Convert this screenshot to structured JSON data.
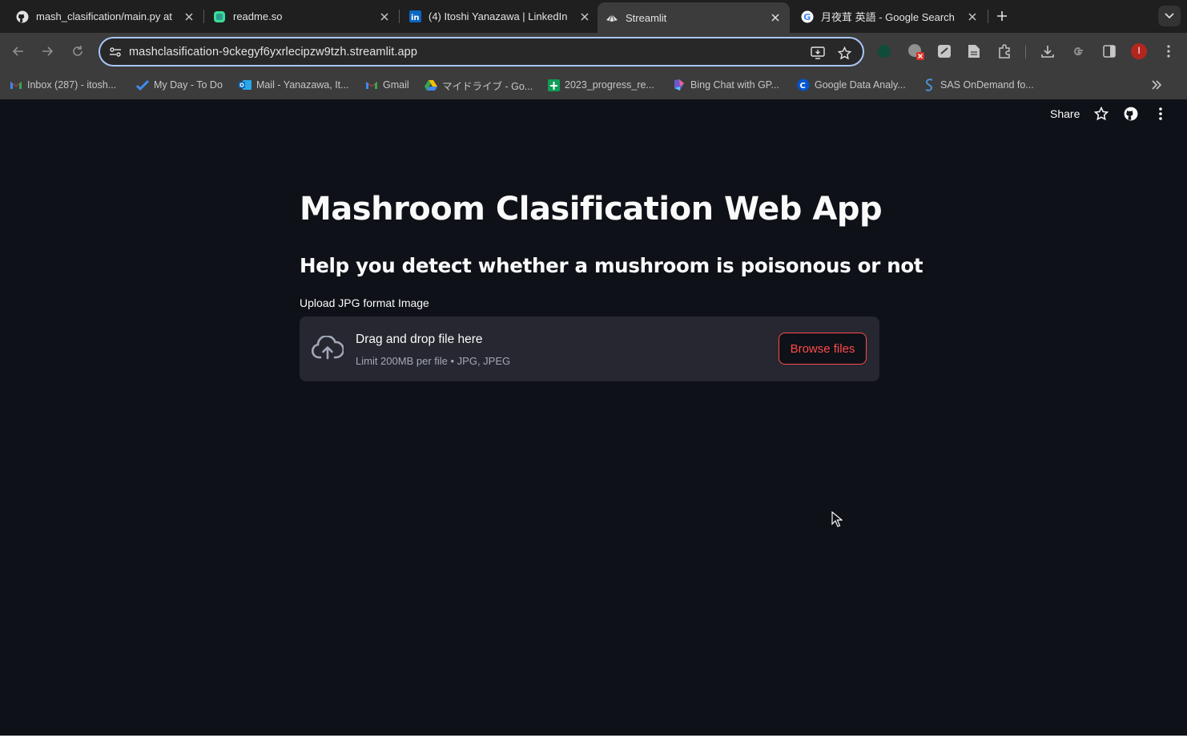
{
  "browser": {
    "tabs": [
      {
        "title": "mash_clasification/main.py at",
        "icon": "github-icon"
      },
      {
        "title": "readme.so",
        "icon": "readme-icon"
      },
      {
        "title": "(4) Itoshi Yanazawa | LinkedIn",
        "icon": "linkedin-icon"
      },
      {
        "title": "Streamlit",
        "icon": "streamlit-icon",
        "active": true
      },
      {
        "title": "月夜茸 英語 - Google Search",
        "icon": "google-icon"
      }
    ],
    "url": "mashclasification-9ckegyf6yxrlecipzw9tzh.streamlit.app",
    "bookmarks": [
      {
        "label": "Inbox (287) - itosh...",
        "icon": "gmail-icon"
      },
      {
        "label": "My Day - To Do",
        "icon": "todo-icon"
      },
      {
        "label": "Mail - Yanazawa, It...",
        "icon": "outlook-icon"
      },
      {
        "label": "Gmail",
        "icon": "gmail-icon"
      },
      {
        "label": "マイドライブ - Go...",
        "icon": "drive-icon"
      },
      {
        "label": "2023_progress_re...",
        "icon": "sheets-icon"
      },
      {
        "label": "Bing Chat with GP...",
        "icon": "bing-icon"
      },
      {
        "label": "Google Data Analy...",
        "icon": "coursera-icon"
      },
      {
        "label": "SAS OnDemand fo...",
        "icon": "sas-icon"
      }
    ],
    "profile_initial": "I"
  },
  "header": {
    "share_label": "Share"
  },
  "main": {
    "title": "Mashroom Clasification Web App",
    "subtitle": "Help you detect whether a mushroom is poisonous or not",
    "uploader": {
      "label": "Upload JPG format Image",
      "instruction": "Drag and drop file here",
      "limits": "Limit 200MB per file • JPG, JPEG",
      "button_label": "Browse files"
    }
  },
  "colors": {
    "page_bg": "#0e1117",
    "dropzone_bg": "#262730",
    "accent": "#ff4b4b",
    "text": "#fafafa"
  }
}
